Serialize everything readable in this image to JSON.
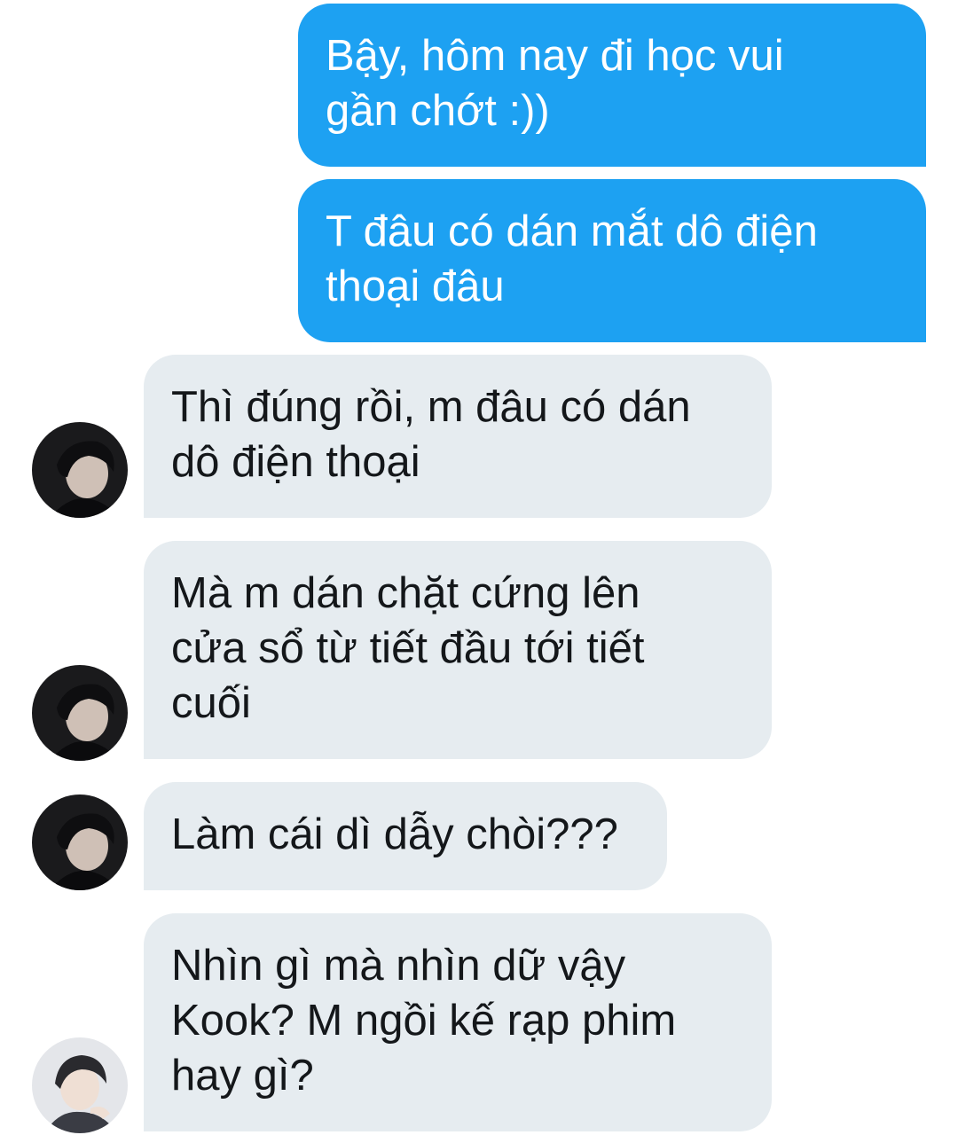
{
  "messages": [
    {
      "direction": "sent",
      "text": "Bậy, hôm nay đi học vui\ngần chớt :))"
    },
    {
      "direction": "sent",
      "text": "T đâu có dán mắt dô điện\nthoại đâu"
    },
    {
      "direction": "received",
      "text": "Thì đúng rồi, m đâu có dán\ndô điện thoại",
      "avatar": "dark-portrait-avatar"
    },
    {
      "direction": "received",
      "text": "Mà m dán chặt cứng lên\ncửa sổ từ tiết đầu tới tiết\ncuối",
      "avatar": "dark-portrait-avatar"
    },
    {
      "direction": "received",
      "text": "Làm cái dì dẫy chòi???",
      "avatar": "dark-portrait-avatar"
    },
    {
      "direction": "received",
      "text": "Nhìn gì mà nhìn dữ vậy\nKook? M ngồi kế rạp phim\nhay gì?",
      "avatar": "light-portrait-avatar"
    }
  ],
  "colors": {
    "sent_bubble": "#1da1f2",
    "received_bubble": "#e6ecf0",
    "sent_text": "#ffffff",
    "received_text": "#14171a"
  }
}
